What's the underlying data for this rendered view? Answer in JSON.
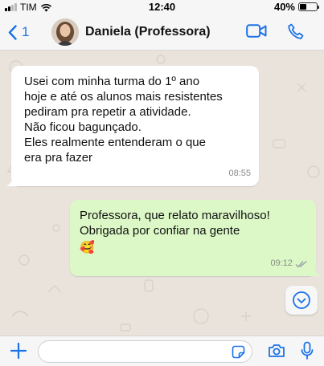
{
  "status_bar": {
    "carrier": "TIM",
    "time": "12:40",
    "battery": "40%",
    "battery_level": 0.4
  },
  "header": {
    "back_count": "1",
    "contact_name": "Daniela (Professora)"
  },
  "messages": [
    {
      "direction": "incoming",
      "lines": [
        "Usei com minha turma do 1º ano",
        "hoje e até os alunos mais resistentes",
        "pediram pra repetir a atividade.",
        "Não ficou bagunçado.",
        "Eles realmente entenderam o que",
        "era pra fazer"
      ],
      "time": "08:55"
    },
    {
      "direction": "outgoing",
      "lines": [
        "Professora, que relato maravilhoso!",
        "Obrigada por confiar na gente"
      ],
      "emoji": "🥰",
      "time": "09:12",
      "status_icon": "double-check-icon"
    }
  ],
  "composer": {
    "placeholder": ""
  },
  "colors": {
    "accent": "#1a73e8",
    "incoming_bubble": "#ffffff",
    "outgoing_bubble": "#dcf8c6",
    "chat_background": "#e9e3db"
  }
}
